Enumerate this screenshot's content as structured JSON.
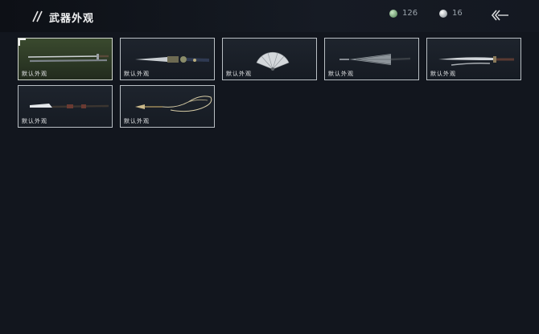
{
  "header": {
    "title": "武器外观",
    "jade_count": "126",
    "pearl_count": "16"
  },
  "cards": [
    {
      "label": "默认外观",
      "weapon": "sword-icon",
      "selected": true
    },
    {
      "label": "默认外观",
      "weapon": "dagger-icon",
      "selected": false
    },
    {
      "label": "默认外观",
      "weapon": "fan-icon",
      "selected": false
    },
    {
      "label": "默认外观",
      "weapon": "umbrella-icon",
      "selected": false
    },
    {
      "label": "默认外观",
      "weapon": "twin-blade-icon",
      "selected": false
    },
    {
      "label": "默认外观",
      "weapon": "spear-icon",
      "selected": false
    },
    {
      "label": "默认外观",
      "weapon": "rope-dart-icon",
      "selected": false
    }
  ]
}
